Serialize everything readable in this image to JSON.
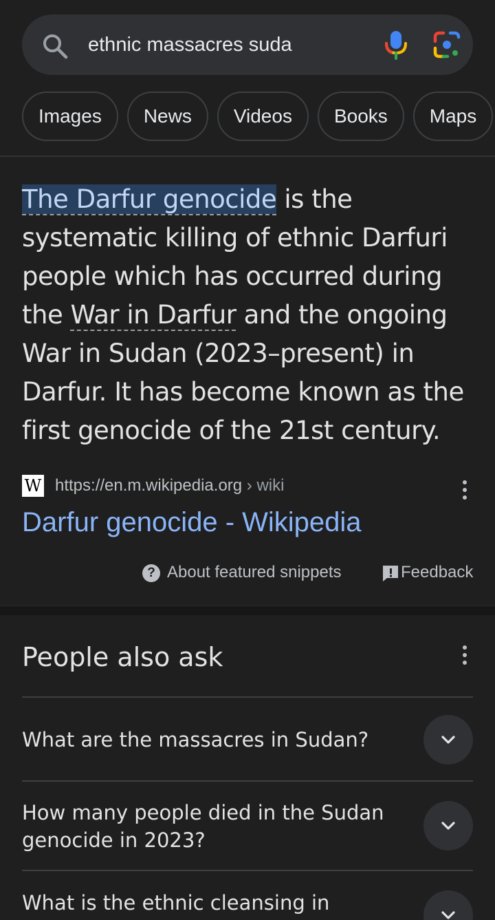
{
  "search": {
    "query": "ethnic massacres suda",
    "icons": [
      "search-icon",
      "mic-icon",
      "lens-icon"
    ]
  },
  "chips": [
    "Images",
    "News",
    "Videos",
    "Books",
    "Maps"
  ],
  "snippet": {
    "highlight": "The Darfur genocide",
    "text_1": " is the systematic killing of ethnic Darfuri people which has occurred during the ",
    "link_term": "War in Darfur",
    "text_2": " and the ongoing War in Sudan (2023–present) in Darfur. It has become known as the first genocide of the 21st century."
  },
  "source": {
    "logo_letter": "W",
    "url": "https://en.m.wikipedia.org",
    "breadcrumb": " › wiki",
    "title": "Darfur genocide - Wikipedia"
  },
  "footer": {
    "about": "About featured snippets",
    "feedback": "Feedback"
  },
  "paa": {
    "title": "People also ask",
    "questions": [
      "What are the massacres in Sudan?",
      "How many people died in the Sudan genocide in 2023?",
      "What is the ethnic cleansing in"
    ]
  },
  "colors": {
    "background": "#1f1f1f",
    "link": "#8ab4f8",
    "highlight_bg": "#28405f"
  }
}
